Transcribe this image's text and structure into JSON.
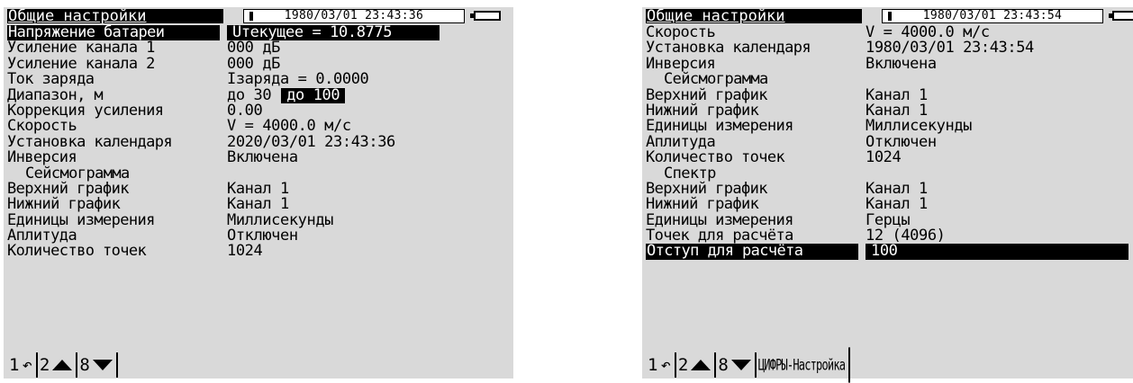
{
  "left": {
    "title": "Общие настройки",
    "clock": "1980/03/01 23:43:36",
    "rows": [
      {
        "label": "Напряжение батареи",
        "value": "Uтекущее = 10.8775"
      },
      {
        "label": "Усиление канала 1",
        "value": "000 дБ"
      },
      {
        "label": "Усиление канала 2",
        "value": "000 дБ"
      },
      {
        "label": "Ток заряда",
        "value": "Iзаряда = 0.0000"
      },
      {
        "label": "Диапазон, м",
        "options": [
          "до 30",
          "до 100"
        ]
      },
      {
        "label": "Коррекция усиления",
        "value": "0.00"
      },
      {
        "label": "Скорость",
        "value": "V = 4000.0 м/с"
      },
      {
        "label": "Установка календаря",
        "value": "2020/03/01 23:43:36"
      },
      {
        "label": "Инверсия",
        "value": "Включена"
      },
      {
        "label": "Сейсмограмма",
        "value": ""
      },
      {
        "label": "Верхний график",
        "value": "Канал 1"
      },
      {
        "label": "Нижний график",
        "value": "Канал 1"
      },
      {
        "label": "Единицы измерения",
        "value": "Миллисекунды"
      },
      {
        "label": "Аплитуда",
        "value": "Отключен"
      },
      {
        "label": "Количество точек",
        "value": "1024"
      }
    ],
    "footer": [
      "1",
      "2",
      "8"
    ]
  },
  "right": {
    "title": "Общие настройки",
    "clock": "1980/03/01 23:43:54",
    "rows": [
      {
        "label": "Скорость",
        "value": "V = 4000.0 м/с"
      },
      {
        "label": "Установка календаря",
        "value": "1980/03/01 23:43:54"
      },
      {
        "label": "Инверсия",
        "value": "Включена"
      },
      {
        "label": "Сейсмограмма",
        "value": ""
      },
      {
        "label": "Верхний график",
        "value": "Канал 1"
      },
      {
        "label": "Нижний график",
        "value": "Канал 1"
      },
      {
        "label": "Единицы измерения",
        "value": "Миллисекунды"
      },
      {
        "label": "Аплитуда",
        "value": "Отключен"
      },
      {
        "label": "Количество точек",
        "value": "1024"
      },
      {
        "label": "Спектр",
        "value": ""
      },
      {
        "label": "Верхний график",
        "value": "Канал 1"
      },
      {
        "label": "Нижний график",
        "value": "Канал 1"
      },
      {
        "label": "Единицы измерения",
        "value": "Герцы"
      },
      {
        "label": "Точек для расчёта",
        "value": "12 (4096)"
      },
      {
        "label": "Отступ для расчёта",
        "value": "100"
      }
    ],
    "footer": [
      "1",
      "2",
      "8",
      "ЦИФРЫ-Настройка"
    ]
  },
  "icons": {
    "return": "return-arrow-icon",
    "up": "triangle-up-icon",
    "down": "triangle-down-icon",
    "battery": "battery-icon"
  },
  "colors": {
    "lcd_background": "#d9d9d9",
    "highlight": "#000000",
    "highlight_text": "#ffffff"
  }
}
